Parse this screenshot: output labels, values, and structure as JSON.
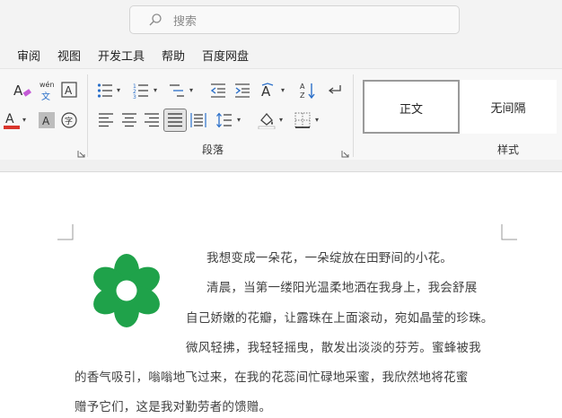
{
  "search": {
    "placeholder": "搜索"
  },
  "menu": [
    "审阅",
    "视图",
    "开发工具",
    "帮助",
    "百度网盘"
  ],
  "font_group": {
    "pinyin_label": "wén",
    "pinyin_char": "文",
    "font_color": "#d9342b",
    "highlight": "#7b2fb5"
  },
  "paragraph_group": {
    "label": "段落"
  },
  "styles_group": {
    "label": "样式",
    "items": [
      "正文",
      "无间隔"
    ]
  },
  "document": {
    "flower_color": "#1fa24a",
    "lines": [
      "我想变成一朵花，一朵绽放在田野间的小花。",
      "清晨，当第一缕阳光温柔地洒在我身上，我会舒展",
      "自己娇嫩的花瓣，让露珠在上面滚动，宛如晶莹的珍珠。",
      "微风轻拂，我轻轻摇曳，散发出淡淡的芬芳。蜜蜂被我",
      "的香气吸引，嗡嗡地飞过来，在我的花蕊间忙碌地采蜜，我欣然地将花蜜",
      "赠予它们，这是我对勤劳者的馈赠。"
    ]
  }
}
